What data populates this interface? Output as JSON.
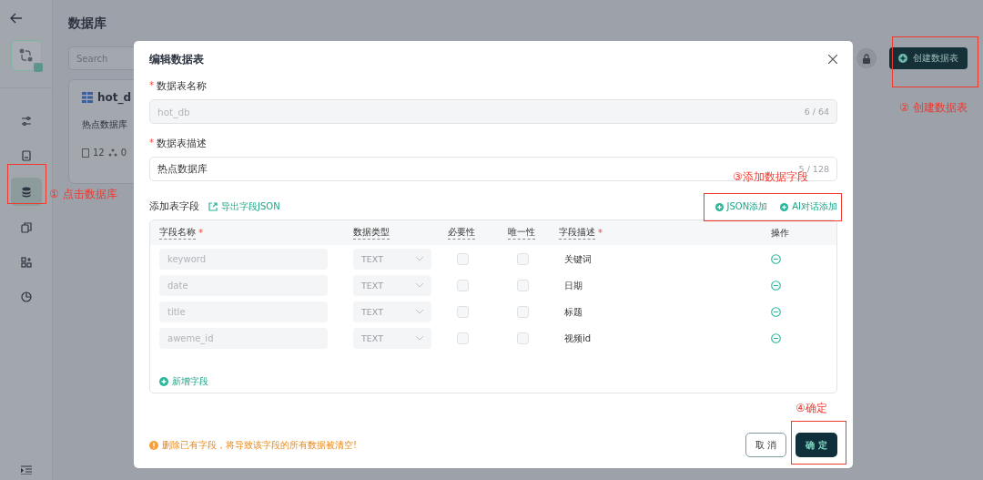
{
  "sidebar": {
    "items": [
      {
        "selected": false
      },
      {
        "selected": false
      },
      {
        "selected": true
      },
      {
        "selected": false
      },
      {
        "selected": false
      },
      {
        "selected": false
      }
    ]
  },
  "page": {
    "title": "数据库",
    "search": {
      "placeholder": "Search"
    },
    "card": {
      "title": "hot_d",
      "description": "热点数据库",
      "stats": [
        "12",
        "0"
      ]
    },
    "create_button": "创建数据表"
  },
  "dialog": {
    "title": "编辑数据表",
    "fields": [
      {
        "label": "数据表名称",
        "required_mark": "*",
        "value": "hot_db",
        "disabled": true,
        "counter": "6 / 64"
      },
      {
        "label": "数据表描述",
        "required_mark": "*",
        "value": "热点数据库",
        "disabled": false,
        "counter": "5 / 128"
      }
    ],
    "section": {
      "title": "添加表字段",
      "export_link": "导出字段JSON",
      "actions": [
        "JSON添加",
        "AI对话添加"
      ]
    },
    "table": {
      "columns": [
        {
          "label": "字段名称",
          "required_mark": "*"
        },
        {
          "label": "数据类型"
        },
        {
          "label": "必要性"
        },
        {
          "label": "唯一性"
        },
        {
          "label": "字段描述",
          "required_mark": "*"
        },
        {
          "label": "操作"
        }
      ],
      "rows": [
        {
          "name": "keyword",
          "type": "TEXT",
          "required": false,
          "unique": false,
          "description": "关键词"
        },
        {
          "name": "date",
          "type": "TEXT",
          "required": false,
          "unique": false,
          "description": "日期"
        },
        {
          "name": "title",
          "type": "TEXT",
          "required": false,
          "unique": false,
          "description": "标题"
        },
        {
          "name": "aweme_id",
          "type": "TEXT",
          "required": false,
          "unique": false,
          "description": "视频id"
        }
      ]
    },
    "add_field": "新增字段",
    "warning": "删除已有字段，将导致该字段的所有数据被清空!",
    "buttons": {
      "cancel": "取 消",
      "ok": "确 定"
    }
  },
  "annotations": [
    {
      "text": "① 点击数据库"
    },
    {
      "text": "② 创建数据表"
    },
    {
      "text": "③添加数据字段"
    },
    {
      "text": "④确定"
    }
  ]
}
